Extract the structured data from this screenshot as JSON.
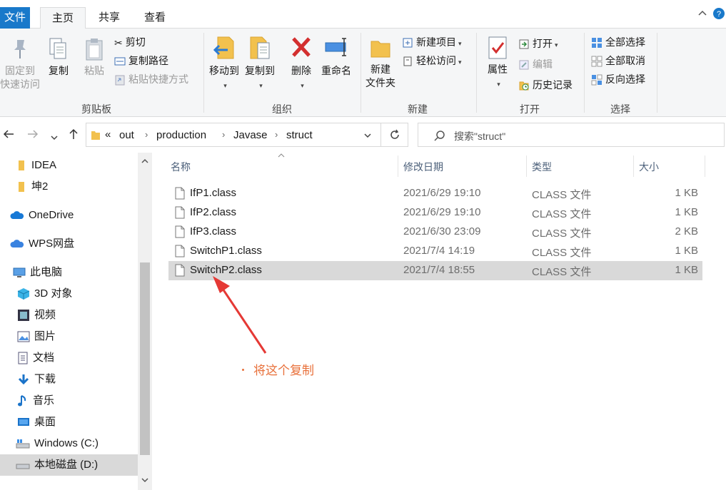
{
  "tabs": {
    "file": "文件",
    "home": "主页",
    "share": "共享",
    "view": "查看"
  },
  "ribbon": {
    "clipboard": {
      "label": "剪贴板",
      "pin": "固定到\n快速访问",
      "pin_l1": "固定到",
      "pin_l2": "快速访问",
      "copy": "复制",
      "paste": "粘贴",
      "cut": "剪切",
      "copy_path": "复制路径",
      "paste_shortcut": "粘贴快捷方式"
    },
    "organize": {
      "label": "组织",
      "move_to": "移动到",
      "copy_to": "复制到",
      "delete": "删除",
      "rename": "重命名"
    },
    "new": {
      "label": "新建",
      "new_folder_l1": "新建",
      "new_folder_l2": "文件夹",
      "new_item": "新建项目",
      "easy_access": "轻松访问"
    },
    "open": {
      "label": "打开",
      "properties": "属性",
      "open": "打开",
      "edit": "编辑",
      "history": "历史记录"
    },
    "select": {
      "label": "选择",
      "select_all": "全部选择",
      "select_none": "全部取消",
      "invert": "反向选择"
    }
  },
  "address": {
    "overflow": "«",
    "crumbs": [
      "out",
      "production",
      "Javase",
      "struct"
    ],
    "search_placeholder": "搜索\"struct\""
  },
  "sidebar": {
    "items": [
      {
        "label": "IDEA",
        "icon": "folder-icon"
      },
      {
        "label": "坤2",
        "icon": "folder-icon"
      },
      {
        "label": "OneDrive",
        "icon": "cloud-icon"
      },
      {
        "label": "WPS网盘",
        "icon": "cloud-icon"
      },
      {
        "label": "此电脑",
        "icon": "computer-icon"
      },
      {
        "label": "3D 对象",
        "icon": "cube-icon"
      },
      {
        "label": "视频",
        "icon": "video-icon"
      },
      {
        "label": "图片",
        "icon": "picture-icon"
      },
      {
        "label": "文档",
        "icon": "document-icon"
      },
      {
        "label": "下载",
        "icon": "download-icon"
      },
      {
        "label": "音乐",
        "icon": "music-icon"
      },
      {
        "label": "桌面",
        "icon": "desktop-icon"
      },
      {
        "label": "Windows (C:)",
        "icon": "drive-icon"
      },
      {
        "label": "本地磁盘 (D:)",
        "icon": "drive-icon",
        "selected": true
      }
    ]
  },
  "columns": {
    "name": "名称",
    "date": "修改日期",
    "type": "类型",
    "size": "大小"
  },
  "files": [
    {
      "name": "IfP1.class",
      "date": "2021/6/29 19:10",
      "type": "CLASS 文件",
      "size": "1 KB"
    },
    {
      "name": "IfP2.class",
      "date": "2021/6/29 19:10",
      "type": "CLASS 文件",
      "size": "1 KB"
    },
    {
      "name": "IfP3.class",
      "date": "2021/6/30 23:09",
      "type": "CLASS 文件",
      "size": "2 KB"
    },
    {
      "name": "SwitchP1.class",
      "date": "2021/7/4 14:19",
      "type": "CLASS 文件",
      "size": "1 KB"
    },
    {
      "name": "SwitchP2.class",
      "date": "2021/7/4 18:55",
      "type": "CLASS 文件",
      "size": "1 KB",
      "selected": true
    }
  ],
  "annotation": {
    "text": "将这个复制",
    "color": "#e8703a"
  },
  "colors": {
    "file_tab": "#1979ca",
    "selection": "#d9d9d9",
    "delete_red": "#d32f2f",
    "folder_yellow": "#f2c14e"
  }
}
